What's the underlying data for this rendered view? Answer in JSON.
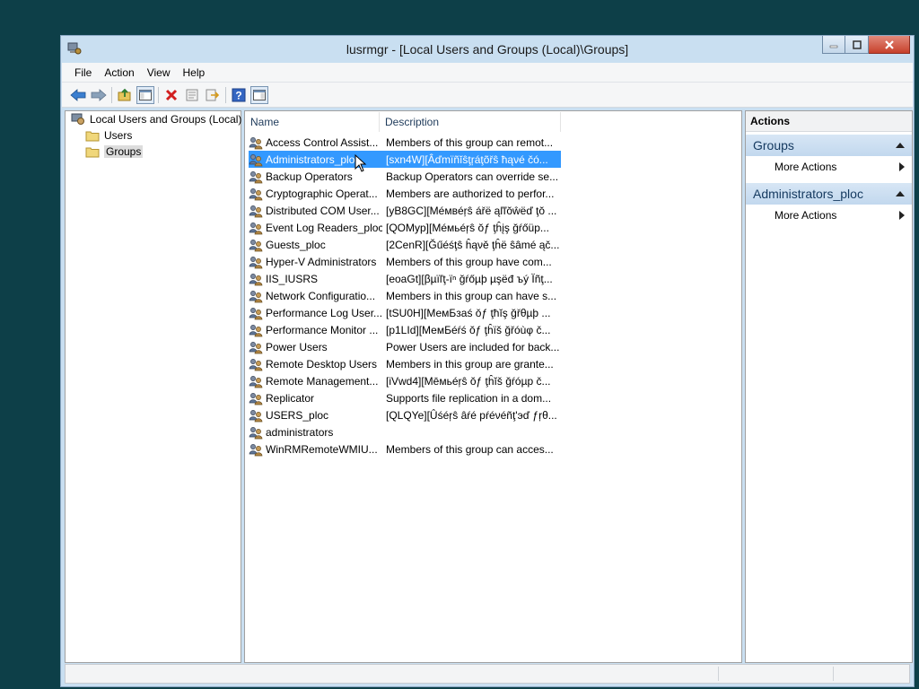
{
  "window": {
    "title": "lusrmgr - [Local Users and Groups (Local)\\Groups]"
  },
  "menu": [
    "File",
    "Action",
    "View",
    "Help"
  ],
  "toolbar_icons": [
    "back-arrow-icon",
    "forward-arrow-icon",
    "up-folder-icon",
    "show-hide-tree-icon",
    "delete-icon",
    "properties-icon",
    "export-list-icon",
    "help-icon",
    "show-hide-action-pane-icon"
  ],
  "tree": {
    "root": "Local Users and Groups (Local)",
    "children": [
      "Users",
      "Groups"
    ],
    "selected": "Groups"
  },
  "list": {
    "columns": [
      "Name",
      "Description"
    ],
    "selected_index": 1,
    "rows": [
      {
        "name": "Access Control Assist...",
        "desc": "Members of this group can remot..."
      },
      {
        "name": "Administrators_ploc",
        "desc": "[sxn4W][Âďmïñĭŝţŗáţõřŝ ħąνé čó..."
      },
      {
        "name": "Backup Operators",
        "desc": "Backup Operators can override se..."
      },
      {
        "name": "Cryptographic Operat...",
        "desc": "Members are authorized to perfor..."
      },
      {
        "name": "Distributed COM User...",
        "desc": "[yB8GC][Мéмвéŗŝ ářë ąľľŏŵëď ţŏ ..."
      },
      {
        "name": "Event Log Readers_ploc",
        "desc": "[QOMyp][Мéмьéŗŝ ŏƒ ţĥįş ğŕőüp..."
      },
      {
        "name": "Guests_ploc",
        "desc": "[2CenR][Ğűéśţŝ ĥąνě ţĥë ŝâmé ąč..."
      },
      {
        "name": "Hyper-V Administrators",
        "desc": "Members of this group have com..."
      },
      {
        "name": "IIS_IUSRS",
        "desc": "[eoaGt][βµïľţ-ïⁿ ğŕőµþ µşëđ ъý Ïñţ..."
      },
      {
        "name": "Network Configuratio...",
        "desc": "Members in this group can have s..."
      },
      {
        "name": "Performance Log User...",
        "desc": "[tSU0H][МемБзаś ǒƒ ţħĭş ğřθµþ ..."
      },
      {
        "name": "Performance Monitor ...",
        "desc": "[p1LId][МемБéŕś ŏƒ ţĥïš ğřóùφ č..."
      },
      {
        "name": "Power Users",
        "desc": "Power Users are included for back..."
      },
      {
        "name": "Remote Desktop Users",
        "desc": "Members in this group are grante..."
      },
      {
        "name": "Remote Management...",
        "desc": "[iVwd4][Мēмьéŗŝ ŏƒ ţĥĭš ğŕóµp č..."
      },
      {
        "name": "Replicator",
        "desc": "Supports file replication in a dom..."
      },
      {
        "name": "USERS_ploc",
        "desc": "[QLQYe][Ûśéŗŝ âŕé pŕéνéñţ'эď ƒŗθ..."
      },
      {
        "name": "administrators",
        "desc": ""
      },
      {
        "name": "WinRMRemoteWMIU...",
        "desc": "Members of this group can acces..."
      }
    ]
  },
  "actions": {
    "header": "Actions",
    "sections": [
      {
        "title": "Groups",
        "item": "More Actions"
      },
      {
        "title": "Administrators_ploc",
        "item": "More Actions"
      }
    ]
  },
  "colors": {
    "desktop": "#0d3f48",
    "titlebar": "#c9dff1",
    "selection": "#3399ff",
    "section_header": "#c8dcf0"
  }
}
